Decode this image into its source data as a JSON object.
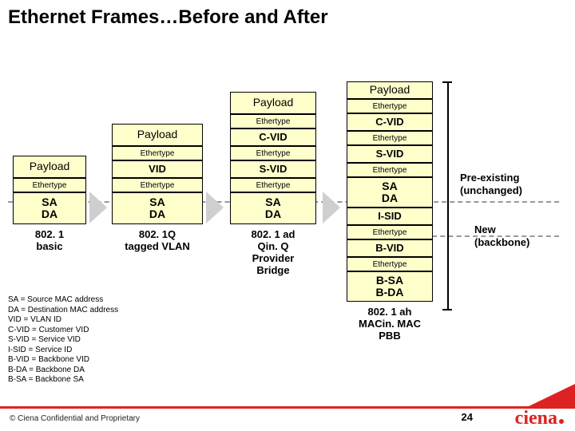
{
  "title": "Ethernet Frames…Before and After",
  "columns": {
    "c1": {
      "cells": [
        "Payload",
        "Ethertype",
        "SA\nDA"
      ],
      "label": "802. 1\nbasic"
    },
    "c2": {
      "cells": [
        "Payload",
        "Ethertype",
        "VID",
        "Ethertype",
        "SA\nDA"
      ],
      "label": "802. 1Q\ntagged VLAN"
    },
    "c3": {
      "cells": [
        "Payload",
        "Ethertype",
        "C-VID",
        "Ethertype",
        "S-VID",
        "Ethertype",
        "SA\nDA"
      ],
      "label": "802. 1 ad\nQin. Q\nProvider\nBridge"
    },
    "c4": {
      "cells": [
        "Payload",
        "Ethertype",
        "C-VID",
        "Ethertype",
        "S-VID",
        "Ethertype",
        "SA\nDA",
        "I-SID",
        "Ethertype",
        "B-VID",
        "Ethertype",
        "B-SA\nB-DA"
      ],
      "label": "802. 1 ah\nMACin. MAC\nPBB"
    }
  },
  "annotations": {
    "preexisting": "Pre-existing\n(unchanged)",
    "newbb": "New\n(backbone)"
  },
  "glossary": "SA = Source MAC address\nDA = Destination MAC address\nVID = VLAN ID\nC-VID = Customer VID\nS-VID = Service VID\nI-SID = Service ID\nB-VID = Backbone VID\nB-DA = Backbone DA\nB-SA = Backbone SA",
  "footer": {
    "copyright": "© Ciena Confidential and Proprietary",
    "page": "24",
    "logo": "ciena"
  }
}
